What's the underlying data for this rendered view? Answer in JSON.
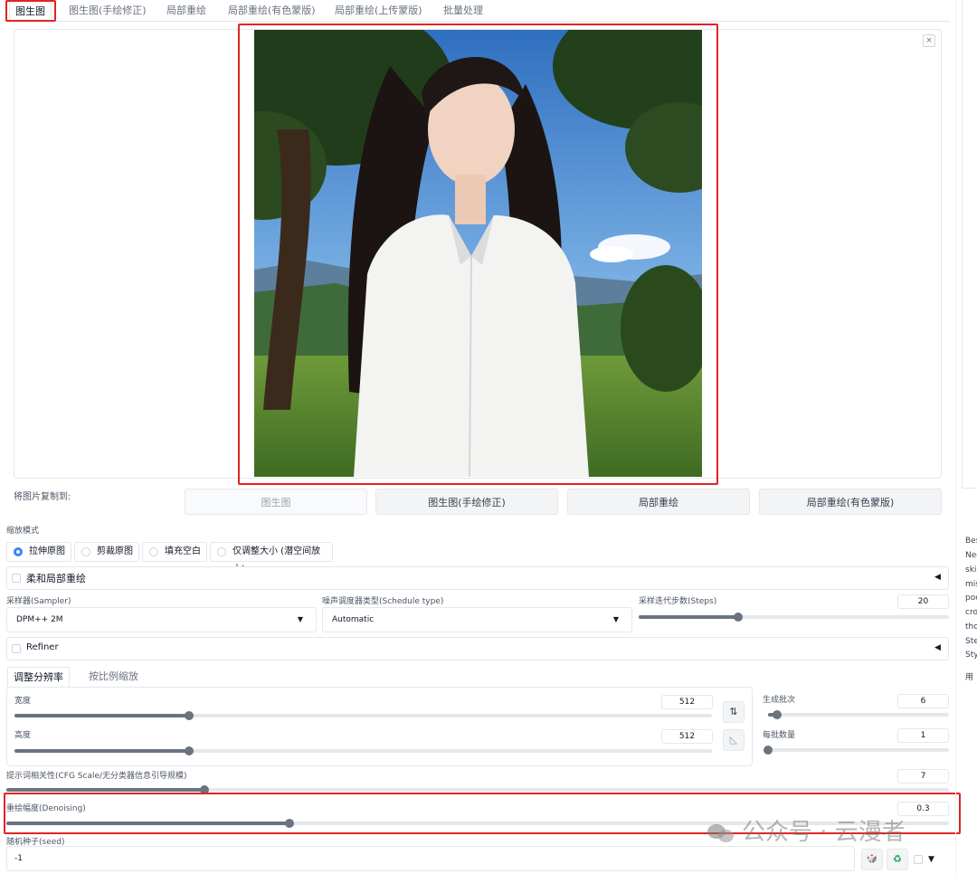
{
  "tabs": [
    "图生图",
    "图生图(手绘修正)",
    "局部重绘",
    "局部重绘(有色蒙版)",
    "局部重绘(上传蒙版)",
    "批量处理"
  ],
  "image_area": {
    "close_symbol": "×"
  },
  "copy_to": {
    "label": "将图片复制到:",
    "buttons": [
      "图生图",
      "图生图(手绘修正)",
      "局部重绘",
      "局部重绘(有色蒙版)"
    ]
  },
  "resize_mode": {
    "label": "缩放模式",
    "options": [
      "拉伸原图",
      "剪裁原图",
      "填充空白",
      "仅调整大小 (潜空间放大)"
    ],
    "selected": "拉伸原图"
  },
  "soft_inpaint": {
    "label": "柔和局部重绘",
    "toggle": "◀"
  },
  "sampler": {
    "label": "采样器(Sampler)",
    "value": "DPM++ 2M",
    "caret": "▼"
  },
  "schedule": {
    "label": "噪声调度器类型(Schedule type)",
    "value": "Automatic",
    "caret": "▼"
  },
  "steps": {
    "label": "采样迭代步数(Steps)",
    "value": "20",
    "fraction": 0.32
  },
  "refiner": {
    "label": "Refiner",
    "toggle": "◀"
  },
  "size_tabs": [
    "调整分辨率",
    "按比例缩放"
  ],
  "width": {
    "label": "宽度",
    "value": "512",
    "fraction": 0.25
  },
  "height": {
    "label": "高度",
    "value": "512",
    "fraction": 0.25
  },
  "swap_icon": "⇅",
  "ratio_icon": "◺",
  "batch_count": {
    "label": "生成批次",
    "value": "6",
    "fraction": 0.05
  },
  "batch_size": {
    "label": "每批数量",
    "value": "1",
    "fraction": 0.0
  },
  "cfg": {
    "label": "提示词相关性(CFG Scale/无分类器信息引导规模)",
    "value": "7",
    "fraction": 0.21
  },
  "denoise": {
    "label": "重绘幅度(Denoising)",
    "value": "0.3",
    "fraction": 0.3
  },
  "seed": {
    "label": "随机种子(seed)",
    "value": "-1",
    "dice_icon": "🎲",
    "recycle_icon": "♻",
    "extra_caret": "▼"
  },
  "sidebar": {
    "lines": [
      "Bes",
      "Neg",
      "skir",
      "mis",
      "poc",
      "cro",
      "tho",
      "Ste",
      "Sty",
      "用"
    ]
  },
  "watermark": "公众号 · 云漫者",
  "colors": {
    "highlight": "#e02424",
    "accent": "#3b82f6",
    "slider": "#6b7280"
  }
}
